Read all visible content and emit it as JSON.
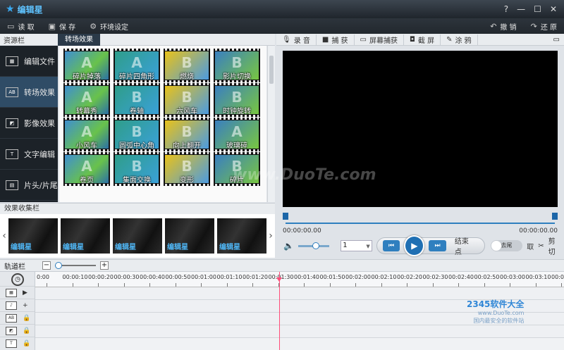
{
  "app": {
    "name": "编辑星",
    "win_controls": [
      "?",
      "—",
      "☐",
      "✕"
    ]
  },
  "toolbar": {
    "open_label": "读 取",
    "save_label": "保 存",
    "settings_label": "环境设定",
    "undo_label": "撤 销",
    "redo_label": "还 原"
  },
  "resource_panel": {
    "title": "资源栏",
    "active_tab": "转场效果"
  },
  "sidebar": {
    "items": [
      {
        "label": "编辑文件"
      },
      {
        "label": "转场效果"
      },
      {
        "label": "影像效果"
      },
      {
        "label": "文字编辑"
      },
      {
        "label": "片头/片尾"
      }
    ]
  },
  "effects": [
    {
      "label": "碎片掉落"
    },
    {
      "label": "碎片四角形"
    },
    {
      "label": "燃烧"
    },
    {
      "label": "影片切换"
    },
    {
      "label": "转幕秀"
    },
    {
      "label": "卷轴"
    },
    {
      "label": "六风车"
    },
    {
      "label": "时钟旋转"
    },
    {
      "label": "小风车"
    },
    {
      "label": "圆弧中心角"
    },
    {
      "label": "向上翻开"
    },
    {
      "label": "玻璃碎"
    },
    {
      "label": "卷页"
    },
    {
      "label": "集面交换"
    },
    {
      "label": "变形"
    },
    {
      "label": "碎片"
    }
  ],
  "collection": {
    "title": "效果收集栏",
    "items": [
      {
        "logo": "编辑星"
      },
      {
        "logo": "编辑星"
      },
      {
        "logo": "编辑星"
      },
      {
        "logo": "编辑星"
      },
      {
        "logo": "编辑星"
      }
    ]
  },
  "preview_toolbar": {
    "record_label": "录 音",
    "capture_label": "捕 获",
    "screen_capture_label": "屏幕捕获",
    "snapshot_label": "截 屏",
    "draw_label": "涂 鸦"
  },
  "player": {
    "time_start": "00:00:00.00",
    "time_end": "00:00:00.00",
    "speed_value": "1",
    "end_point_label": "结束点",
    "toggle_label": "去尾",
    "cut_label": "剪 切",
    "split_label": "取"
  },
  "timeline": {
    "title": "轨道栏",
    "ruler": [
      "0:00",
      "00:00:10",
      "00:00:20",
      "00:00:30",
      "00:00:40",
      "00:00:50",
      "00:01:00",
      "00:01:10",
      "00:01:20",
      "00:01:30",
      "00:01:40",
      "00:01:50",
      "00:02:00",
      "00:02:10",
      "00:02:20",
      "00:02:30",
      "00:02:40",
      "00:02:50",
      "00:03:00",
      "00:03:10",
      "00:03:20"
    ]
  },
  "watermarks": {
    "duote": "www.DuoTe.com",
    "brand": "2345软件大全",
    "brand_url": "www.DuoTe.com",
    "brand_sub": "国内最安全的软件站"
  }
}
